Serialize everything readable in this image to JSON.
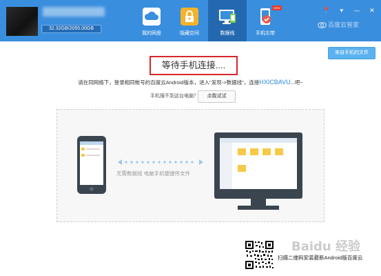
{
  "header": {
    "quota": "32.32GB/2055.00GB",
    "quota_used_fraction": 0.016,
    "nav": [
      {
        "label": "我的网盘",
        "icon": "cloud-icon",
        "active": false
      },
      {
        "label": "隐藏空间",
        "icon": "lock-icon",
        "active": false
      },
      {
        "label": "数据线",
        "icon": "data-cable-icon",
        "active": true
      },
      {
        "label": "手机忘带",
        "icon": "phone-icon",
        "active": false,
        "badge": "NEW"
      }
    ],
    "brand": "百度云管家",
    "colors": {
      "header_bg": "#3a8ede",
      "active_tab": "#2469b0"
    }
  },
  "main": {
    "receive_button": "来自手机的文件",
    "waiting_title": "等待手机连接....",
    "instruction_prefix": "请在同网络下，登录相同帐号的百度云Android版本，进入\"发现->数据线\"，连接",
    "instruction_code": "HXICBAVU",
    "instruction_suffix": "...吧~",
    "not_found_label": "手机搜不到这台电脑？",
    "try_button": "点我试试",
    "transfer_text": "无需数据线 电脑手机便捷传文件",
    "qr_text": "扫描二维码安装最新Android版百度云",
    "watermark": "Baidu 经验",
    "colors": {
      "highlight_box": "#d6262a",
      "accent": "#2b88e0"
    }
  }
}
